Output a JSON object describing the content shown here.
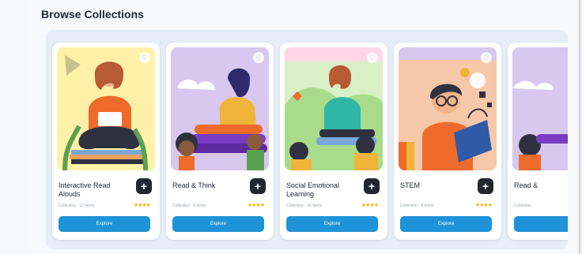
{
  "section": {
    "title": "Browse Collections"
  },
  "cards": [
    {
      "name": "Interactive Read Alouds",
      "meta": "Collection · 12 items",
      "stars": "★★★★",
      "button": "Explore"
    },
    {
      "name": "Read & Think",
      "meta": "Collection · 9 items",
      "stars": "★★★★",
      "button": "Explore"
    },
    {
      "name": "Social Emotional Learning",
      "meta": "Collection · 10 items",
      "stars": "★★★★",
      "button": "Explore"
    },
    {
      "name": "STEM",
      "meta": "Collection · 8 items",
      "stars": "★★★★",
      "button": "Explore"
    },
    {
      "name": "Read &",
      "meta": "Collection",
      "stars": "",
      "button": ""
    }
  ],
  "icons": {
    "favorite": "heart-icon",
    "add": "plus-icon"
  },
  "colors": {
    "accent": "#1f93d8",
    "add_button": "#23262e",
    "stars": "#f4b400"
  }
}
